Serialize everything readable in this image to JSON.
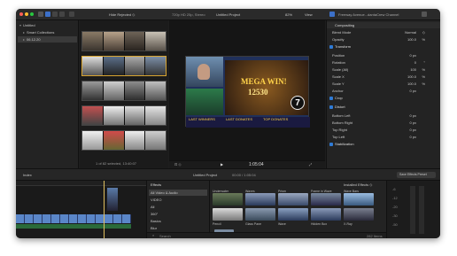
{
  "titlebar": {
    "filter_label": "Hide Rejected ◇",
    "viewer_info": "720p HD 25p, Stereo",
    "project_title": "Untitled Project",
    "zoom": "82%",
    "view_label": "View",
    "inspector_title": "Freeway Avenue...dantaCrew Channel"
  },
  "library": {
    "items": [
      {
        "label": "Untitled",
        "selected": false
      },
      {
        "label": "Smart Collections",
        "selected": false
      },
      {
        "label": "06.12.20",
        "selected": true
      }
    ]
  },
  "browser": {
    "status": "1 of 82 selected, 13:40:07"
  },
  "viewer": {
    "overlay_text": "MEGA WIN!",
    "overlay_amount": "12530",
    "badge_number": "7",
    "timecode": "1:05:04",
    "bottom_labels": [
      "LAST WINNERS",
      "LAST DONATES",
      "TOP DONATES"
    ]
  },
  "inspector": {
    "sections": [
      {
        "type": "head",
        "label": "Compositing"
      },
      {
        "type": "row",
        "label": "Blend Mode",
        "value": "Normal",
        "unit": "◇"
      },
      {
        "type": "row",
        "label": "Opacity",
        "value": "100.0",
        "unit": "%"
      },
      {
        "type": "check",
        "label": "Transform"
      },
      {
        "type": "row",
        "label": "Position",
        "value": "0 px",
        "unit": ""
      },
      {
        "type": "row",
        "label": "Rotation",
        "value": "0",
        "unit": "°"
      },
      {
        "type": "row",
        "label": "Scale (All)",
        "value": "100",
        "unit": "%"
      },
      {
        "type": "row",
        "label": "Scale X",
        "value": "100.0",
        "unit": "%"
      },
      {
        "type": "row",
        "label": "Scale Y",
        "value": "100.0",
        "unit": "%"
      },
      {
        "type": "row",
        "label": "Anchor",
        "value": "0 px",
        "unit": ""
      },
      {
        "type": "check",
        "label": "Crop"
      },
      {
        "type": "check",
        "label": "Distort"
      },
      {
        "type": "row",
        "label": "Bottom Left",
        "value": "0 px",
        "unit": ""
      },
      {
        "type": "row",
        "label": "Bottom Right",
        "value": "0 px",
        "unit": ""
      },
      {
        "type": "row",
        "label": "Top Right",
        "value": "0 px",
        "unit": ""
      },
      {
        "type": "row",
        "label": "Top Left",
        "value": "0 px",
        "unit": ""
      },
      {
        "type": "check",
        "label": "Stabilization"
      }
    ],
    "save_preset": "Save Effects Preset"
  },
  "midbar": {
    "index_label": "Index",
    "project_title": "Untitled Project",
    "timecode": "00:00 / 1:05:04"
  },
  "effects": {
    "title": "Effects",
    "installed_label": "Installed Effects ◇",
    "categories": [
      {
        "label": "All Video & Audio",
        "selected": true
      },
      {
        "label": "VIDEO",
        "selected": false
      },
      {
        "label": "All",
        "selected": false
      },
      {
        "label": "360°",
        "selected": false
      },
      {
        "label": "Basics",
        "selected": false
      },
      {
        "label": "Blur",
        "selected": false
      }
    ],
    "row1_labels": [
      "Underwater",
      "Waves",
      "Prism",
      "Frame in Wave",
      "Wave Bars"
    ],
    "row2_labels": [
      "Pencil",
      "Glass Pane",
      "Wave",
      "Hidden Box",
      "X-Ray"
    ],
    "search_placeholder": "Search",
    "count": "282 Items"
  },
  "meters": {
    "labels": [
      "-6",
      "-12",
      "-20",
      "-30",
      "-50"
    ]
  }
}
